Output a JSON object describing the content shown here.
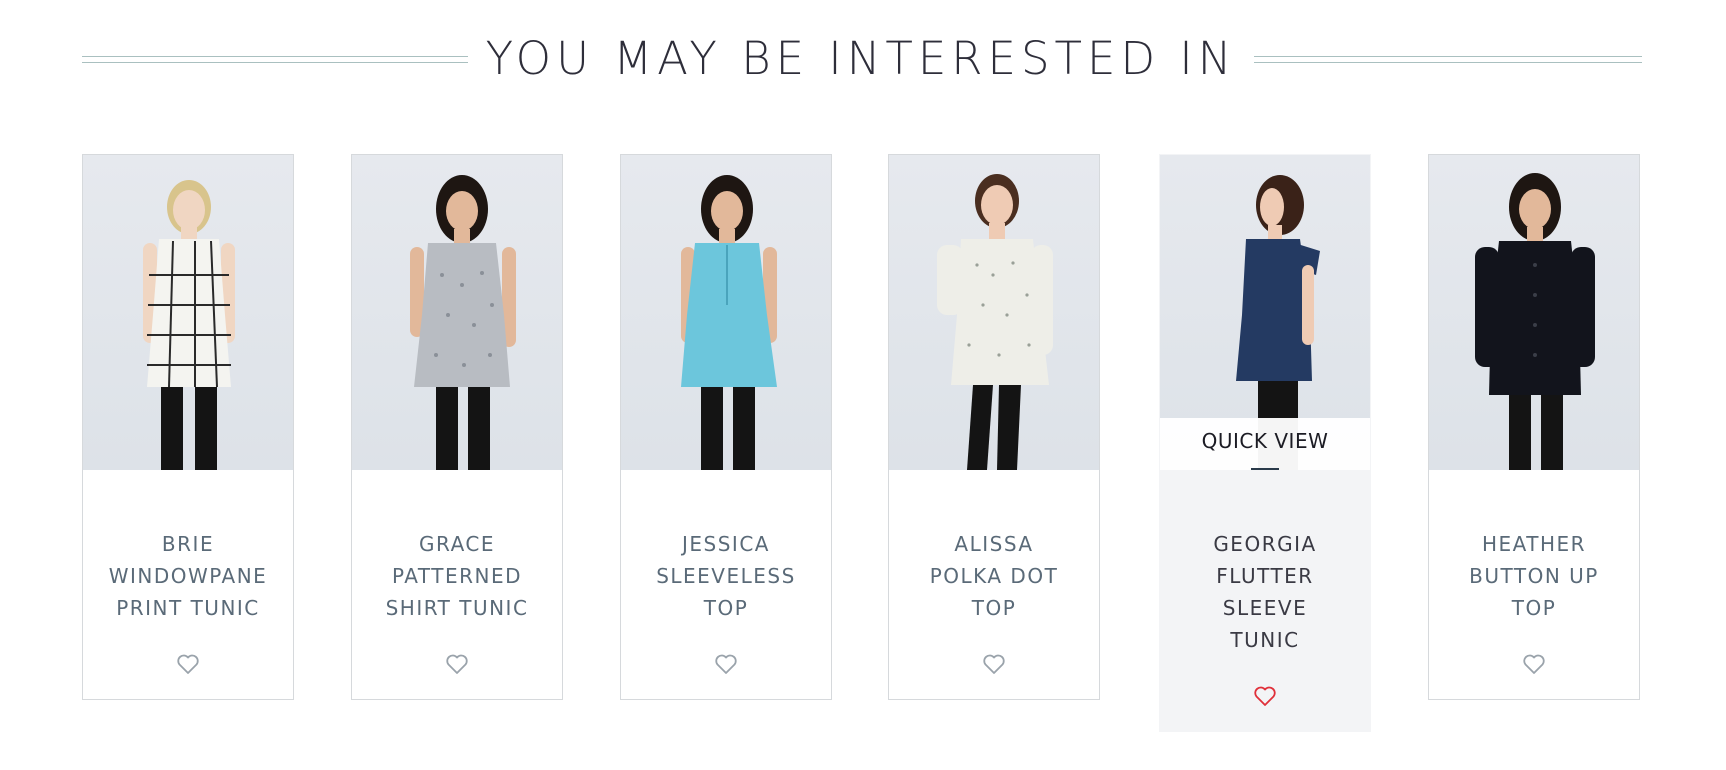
{
  "section": {
    "title": "YOU MAY BE INTERESTED IN"
  },
  "products": [
    {
      "name": "BRIE\nWINDOWPANE\nPRINT TUNIC",
      "garment": "white windowpane check sleeveless tunic",
      "hair": "blonde",
      "favorited": false,
      "quick_view": false
    },
    {
      "name": "GRACE\nPATTERNED\nSHIRT TUNIC",
      "garment": "grey patterned sleeveless tunic",
      "hair": "dark",
      "favorited": false,
      "quick_view": false
    },
    {
      "name": "JESSICA\nSLEEVELESS\nTOP",
      "garment": "aqua blue sleeveless top",
      "hair": "dark",
      "favorited": false,
      "quick_view": false
    },
    {
      "name": "ALISSA\nPOLKA DOT\nTOP",
      "garment": "white polka dot top",
      "hair": "brown",
      "favorited": false,
      "quick_view": false
    },
    {
      "name": "GEORGIA\nFLUTTER\nSLEEVE\nTUNIC",
      "garment": "navy flutter sleeve tunic",
      "hair": "brown",
      "favorited": true,
      "quick_view": true
    },
    {
      "name": "HEATHER\nBUTTON UP\nTOP",
      "garment": "black button up top",
      "hair": "dark",
      "favorited": false,
      "quick_view": false
    }
  ],
  "quick_view_label": "QUICK VIEW",
  "icons": {
    "favorite": "heart-outline-icon"
  },
  "colors": {
    "title": "#2e2e3a",
    "product_name": "#5a6a78",
    "heart_default": "#9aa3ab",
    "heart_active": "#e0303a",
    "active_card_bg": "#f3f4f6",
    "garments": [
      "#f4f4f0",
      "#b8bcc2",
      "#6cc6dc",
      "#eeeee8",
      "#243a62",
      "#12141c"
    ]
  }
}
